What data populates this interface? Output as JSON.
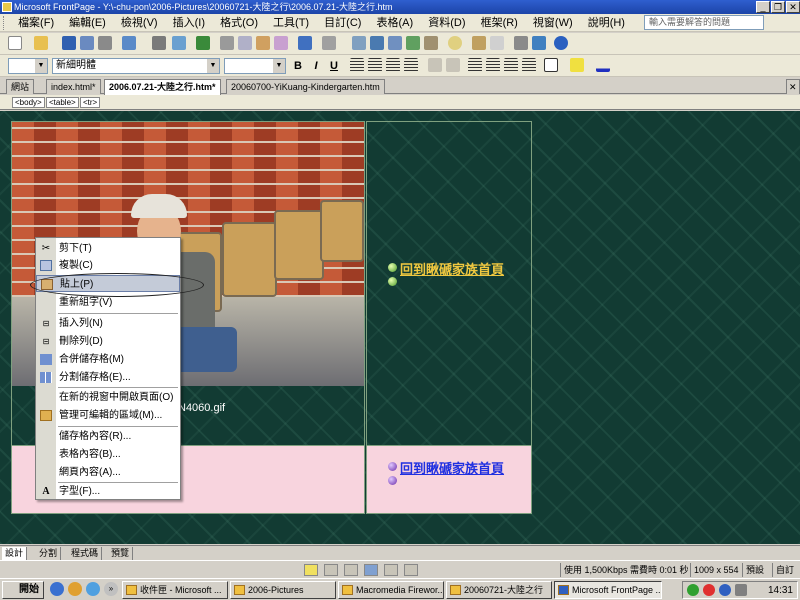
{
  "window": {
    "title": "Microsoft FrontPage - Y:\\-chu-pon\\2006-Pictures\\20060721-大陸之行\\2006.07.21-大陸之行.htm",
    "controls": [
      "_",
      "❐",
      "✕"
    ]
  },
  "menubar": {
    "items": [
      "檔案(F)",
      "編輯(E)",
      "檢視(V)",
      "插入(I)",
      "格式(O)",
      "工具(T)",
      "目訂(C)",
      "表格(A)",
      "資料(D)",
      "框架(R)",
      "視窗(W)",
      "說明(H)"
    ],
    "help_placeholder": "輸入需要解答的問題"
  },
  "format_toolbar": {
    "style_value": "",
    "font_value": "新細明體",
    "size_value": "",
    "bold": "B",
    "italic": "I",
    "underline": "U"
  },
  "doc_tabs": {
    "items": [
      "網站",
      "index.html*",
      "2006.07.21-大陸之行.htm*",
      "20060700-YiKuang-Kindergarten.htm"
    ],
    "active_index": 2
  },
  "tag_path": [
    "<body>",
    "<table>",
    "<tr>"
  ],
  "page": {
    "caption": "N4060.gif",
    "nav_link_top": "回到瞅磃家族首頁",
    "nav_link_bottom": "回到瞅磃家族首頁"
  },
  "context_menu": {
    "items": [
      {
        "label": "剪下(T)",
        "icon": "scissors-icon"
      },
      {
        "label": "複製(C)",
        "icon": "copy-icon"
      },
      {
        "label": "貼上(P)",
        "icon": "paste-icon"
      },
      {
        "label": "重新組字(V)",
        "icon": ""
      },
      {
        "label": "插入列(N)",
        "icon": "insert-row-icon"
      },
      {
        "label": "刪除列(D)",
        "icon": "delete-row-icon"
      },
      {
        "label": "合併儲存格(M)",
        "icon": "merge-cells-icon"
      },
      {
        "label": "分割儲存格(E)...",
        "icon": "split-cells-icon"
      },
      {
        "label": "在新的視窗中開啟頁面(O)",
        "icon": ""
      },
      {
        "label": "管理可編輯的區域(M)...",
        "icon": "editable-region-icon"
      },
      {
        "label": "儲存格內容(R)...",
        "icon": ""
      },
      {
        "label": "表格內容(B)...",
        "icon": ""
      },
      {
        "label": "網頁內容(A)...",
        "icon": ""
      },
      {
        "label": "字型(F)...",
        "icon": "font-icon"
      }
    ],
    "highlighted_index": 2
  },
  "view_tabs": [
    "設計",
    "分割",
    "程式碼",
    "預覽"
  ],
  "status": {
    "speed": "使用 1,500Kbps 需費時 0:01 秒",
    "page_size": "1009 x 554",
    "mode": "預設",
    "extra": "自訂"
  },
  "taskbar": {
    "start": "開始",
    "tasks": [
      "收件匣 - Microsoft ...",
      "2006-Pictures",
      "Macromedia Firewor...",
      "20060721-大陸之行",
      "Microsoft FrontPage ..."
    ],
    "active_index": 4,
    "clock": "14:31"
  }
}
